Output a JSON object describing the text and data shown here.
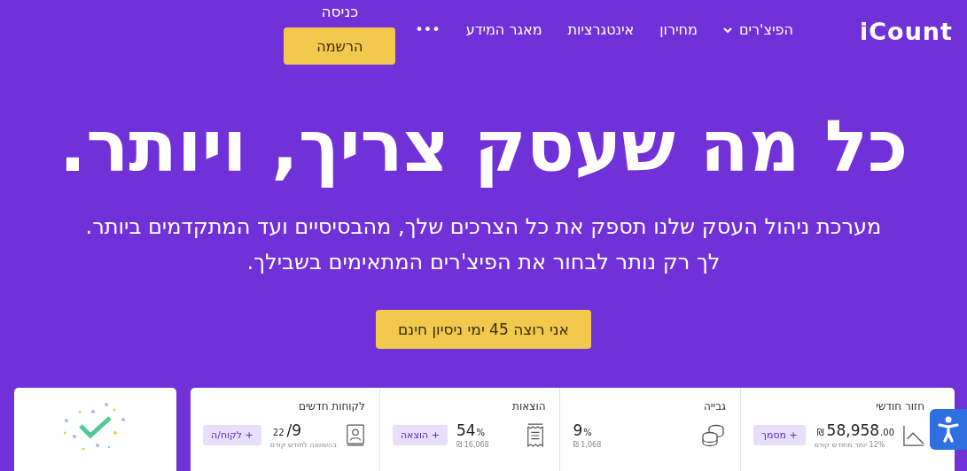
{
  "logo": "iCount",
  "nav": {
    "items": [
      {
        "label": "הפיצ'רים",
        "dropdown": true
      },
      {
        "label": "מחירון",
        "dropdown": false
      },
      {
        "label": "אינטגרציות",
        "dropdown": false
      },
      {
        "label": "מאגר המידע",
        "dropdown": false
      },
      {
        "label": "•••",
        "dropdown": false
      }
    ],
    "login": "כניסה",
    "signup": "הרשמה"
  },
  "hero": {
    "title": "כל מה שעסק צריך, ויותר.",
    "lines": [
      "מערכת ניהול העסק שלנו תספק את כל הצרכים שלך, מהבסיסיים ועד המתקדמים ביותר.",
      "לך רק נותר לבחור את הפיצ'רים המתאימים בשבילך."
    ],
    "cta": "אני רוצה 45 ימי ניסיון חינם"
  },
  "stats": [
    {
      "title": "חזור חודשי",
      "kind": "chart",
      "pre": "₪",
      "value": "58,958",
      "post": ".00",
      "sub": "12% יותר מחודש קודם",
      "button": "+ מסמך"
    },
    {
      "title": "גבייה",
      "kind": "coins",
      "value": "9",
      "post": "%",
      "sub": "1,068 ₪"
    },
    {
      "title": "הוצאות",
      "kind": "receipt",
      "value": "54",
      "post": "%",
      "sub": "16,068 ₪",
      "button": "+ הוצאה"
    },
    {
      "title": "לקוחות חדשים",
      "kind": "contacts",
      "pre": "22",
      "value": "/9",
      "sub": "בהשוואה לחודש קודם",
      "button": "+ לקוח/ה"
    }
  ]
}
